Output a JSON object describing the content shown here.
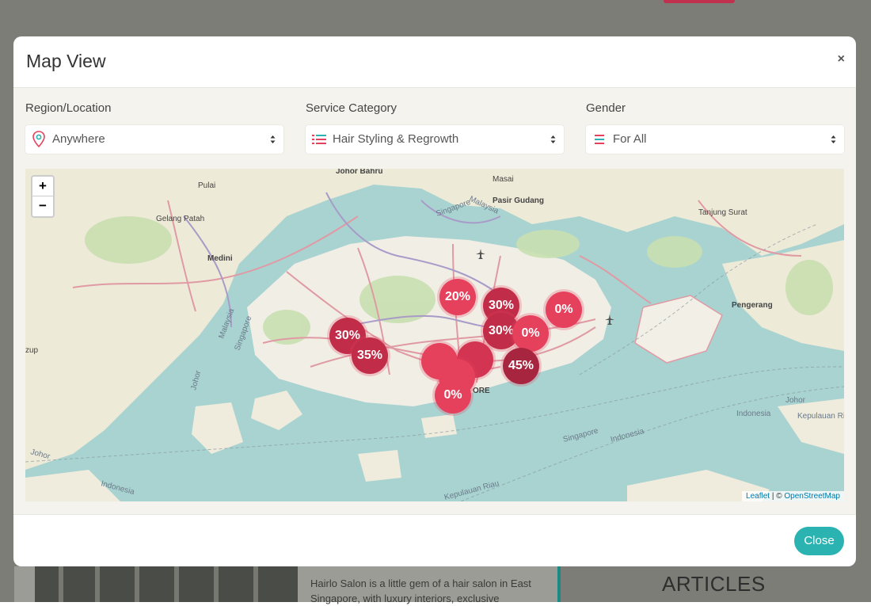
{
  "background": {
    "card_text": "Hairlo Salon is a little gem of a hair salon in East Singapore, with luxury interiors, exclusive",
    "articles_heading": "ARTICLES"
  },
  "modal": {
    "title": "Map View",
    "close_icon": "×",
    "filters": [
      {
        "label": "Region/Location",
        "value": "Anywhere",
        "icon": "location-pin-icon"
      },
      {
        "label": "Service Category",
        "value": "Hair Styling & Regrowth",
        "icon": "list-icon"
      },
      {
        "label": "Gender",
        "value": "For All",
        "icon": "lines-icon"
      }
    ],
    "map": {
      "zoom_in": "+",
      "zoom_out": "−",
      "attribution_leaflet": "Leaflet",
      "attribution_sep": " | © ",
      "attribution_osm": "OpenStreetMap",
      "place_labels": [
        "Johor Bahru",
        "Masai",
        "Pasir Gudang",
        "Pulai",
        "Gelang Patah",
        "Medini",
        "Tanjung Surat",
        "Pengerang",
        "Singapore",
        "Malaysia",
        "Johor",
        "Indonesia",
        "Kepulauan Riau",
        "ORE",
        "zup"
      ],
      "markers": [
        "20%",
        "30%",
        "30%",
        "0%",
        "30%",
        "35%",
        "0%",
        "45%",
        "0%"
      ],
      "colors": {
        "marker": "#e5405c",
        "marker_dark": "#c12c48",
        "water": "#a9d3d1",
        "land": "#f1eee6",
        "road": "#e09aa4"
      }
    },
    "close_button": "Close"
  }
}
